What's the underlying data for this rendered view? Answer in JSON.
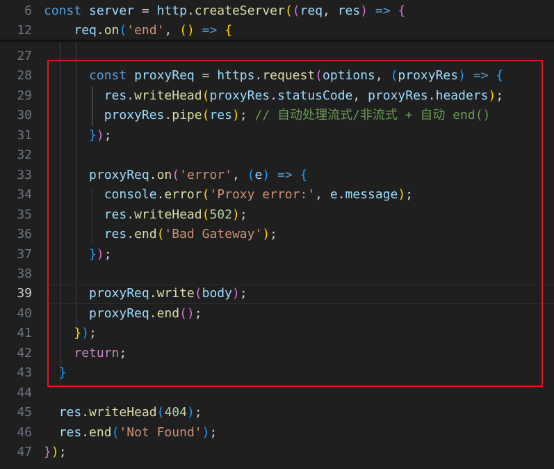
{
  "editor": {
    "active_line": "39",
    "sticky_lines": [
      {
        "num": "6",
        "code": [
          [
            "t-kw",
            "const "
          ],
          [
            "t-var",
            "server"
          ],
          [
            "t-op",
            " = "
          ],
          [
            "t-var",
            "http"
          ],
          [
            "t-op",
            "."
          ],
          [
            "t-fn",
            "createServer"
          ],
          [
            "t-b1",
            "("
          ],
          [
            "t-b2",
            "("
          ],
          [
            "t-var",
            "req"
          ],
          [
            "t-op",
            ", "
          ],
          [
            "t-var",
            "res"
          ],
          [
            "t-b2",
            ")"
          ],
          [
            "t-op",
            " "
          ],
          [
            "t-kw",
            "=>"
          ],
          [
            "t-op",
            " "
          ],
          [
            "t-b2",
            "{"
          ]
        ]
      },
      {
        "num": "12",
        "code": [
          [
            "t-op",
            "    "
          ],
          [
            "t-var",
            "req"
          ],
          [
            "t-op",
            "."
          ],
          [
            "t-fn",
            "on"
          ],
          [
            "t-b3",
            "("
          ],
          [
            "t-str",
            "'end'"
          ],
          [
            "t-op",
            ", "
          ],
          [
            "t-b1",
            "()"
          ],
          [
            "t-op",
            " "
          ],
          [
            "t-kw",
            "=>"
          ],
          [
            "t-op",
            " "
          ],
          [
            "t-b1",
            "{"
          ]
        ]
      }
    ],
    "lines": [
      {
        "num": "27",
        "code": [
          [
            "t-op",
            "    "
          ]
        ]
      },
      {
        "num": "28",
        "code": [
          [
            "t-op",
            "      "
          ],
          [
            "t-kw",
            "const "
          ],
          [
            "t-var",
            "proxyReq"
          ],
          [
            "t-op",
            " = "
          ],
          [
            "t-var",
            "https"
          ],
          [
            "t-op",
            "."
          ],
          [
            "t-fn",
            "request"
          ],
          [
            "t-b2",
            "("
          ],
          [
            "t-var",
            "options"
          ],
          [
            "t-op",
            ", "
          ],
          [
            "t-b3",
            "("
          ],
          [
            "t-var",
            "proxyRes"
          ],
          [
            "t-b3",
            ")"
          ],
          [
            "t-op",
            " "
          ],
          [
            "t-kw",
            "=>"
          ],
          [
            "t-op",
            " "
          ],
          [
            "t-b3",
            "{"
          ]
        ]
      },
      {
        "num": "29",
        "code": [
          [
            "t-op",
            "        "
          ],
          [
            "t-var",
            "res"
          ],
          [
            "t-op",
            "."
          ],
          [
            "t-fn",
            "writeHead"
          ],
          [
            "t-b1",
            "("
          ],
          [
            "t-var",
            "proxyRes"
          ],
          [
            "t-op",
            "."
          ],
          [
            "t-var",
            "statusCode"
          ],
          [
            "t-op",
            ", "
          ],
          [
            "t-var",
            "proxyRes"
          ],
          [
            "t-op",
            "."
          ],
          [
            "t-var",
            "headers"
          ],
          [
            "t-b1",
            ")"
          ],
          [
            "t-op",
            ";"
          ]
        ]
      },
      {
        "num": "30",
        "code": [
          [
            "t-op",
            "        "
          ],
          [
            "t-var",
            "proxyRes"
          ],
          [
            "t-op",
            "."
          ],
          [
            "t-fn",
            "pipe"
          ],
          [
            "t-b1",
            "("
          ],
          [
            "t-var",
            "res"
          ],
          [
            "t-b1",
            ")"
          ],
          [
            "t-op",
            "; "
          ],
          [
            "t-cmt",
            "// 自动处理流式/非流式 + 自动 end()"
          ]
        ]
      },
      {
        "num": "31",
        "code": [
          [
            "t-op",
            "      "
          ],
          [
            "t-b3",
            "}"
          ],
          [
            "t-b2",
            ")"
          ],
          [
            "t-op",
            ";"
          ]
        ]
      },
      {
        "num": "32",
        "code": [
          [
            "t-op",
            ""
          ]
        ]
      },
      {
        "num": "33",
        "code": [
          [
            "t-op",
            "      "
          ],
          [
            "t-var",
            "proxyReq"
          ],
          [
            "t-op",
            "."
          ],
          [
            "t-fn",
            "on"
          ],
          [
            "t-b2",
            "("
          ],
          [
            "t-str",
            "'error'"
          ],
          [
            "t-op",
            ", "
          ],
          [
            "t-b3",
            "("
          ],
          [
            "t-var",
            "e"
          ],
          [
            "t-b3",
            ")"
          ],
          [
            "t-op",
            " "
          ],
          [
            "t-kw",
            "=>"
          ],
          [
            "t-op",
            " "
          ],
          [
            "t-b3",
            "{"
          ]
        ]
      },
      {
        "num": "34",
        "code": [
          [
            "t-op",
            "        "
          ],
          [
            "t-var",
            "console"
          ],
          [
            "t-op",
            "."
          ],
          [
            "t-fn",
            "error"
          ],
          [
            "t-b1",
            "("
          ],
          [
            "t-str",
            "'Proxy error:'"
          ],
          [
            "t-op",
            ", "
          ],
          [
            "t-var",
            "e"
          ],
          [
            "t-op",
            "."
          ],
          [
            "t-var",
            "message"
          ],
          [
            "t-b1",
            ")"
          ],
          [
            "t-op",
            ";"
          ]
        ]
      },
      {
        "num": "35",
        "code": [
          [
            "t-op",
            "        "
          ],
          [
            "t-var",
            "res"
          ],
          [
            "t-op",
            "."
          ],
          [
            "t-fn",
            "writeHead"
          ],
          [
            "t-b1",
            "("
          ],
          [
            "t-num",
            "502"
          ],
          [
            "t-b1",
            ")"
          ],
          [
            "t-op",
            ";"
          ]
        ]
      },
      {
        "num": "36",
        "code": [
          [
            "t-op",
            "        "
          ],
          [
            "t-var",
            "res"
          ],
          [
            "t-op",
            "."
          ],
          [
            "t-fn",
            "end"
          ],
          [
            "t-b1",
            "("
          ],
          [
            "t-str",
            "'Bad Gateway'"
          ],
          [
            "t-b1",
            ")"
          ],
          [
            "t-op",
            ";"
          ]
        ]
      },
      {
        "num": "37",
        "code": [
          [
            "t-op",
            "      "
          ],
          [
            "t-b3",
            "}"
          ],
          [
            "t-b2",
            ")"
          ],
          [
            "t-op",
            ";"
          ]
        ]
      },
      {
        "num": "38",
        "code": [
          [
            "t-op",
            ""
          ]
        ]
      },
      {
        "num": "39",
        "code": [
          [
            "t-op",
            "      "
          ],
          [
            "t-var",
            "proxyReq"
          ],
          [
            "t-op",
            "."
          ],
          [
            "t-fn",
            "write"
          ],
          [
            "t-b2",
            "("
          ],
          [
            "t-var",
            "body"
          ],
          [
            "t-b2",
            ")"
          ],
          [
            "t-op",
            ";"
          ]
        ]
      },
      {
        "num": "40",
        "code": [
          [
            "t-op",
            "      "
          ],
          [
            "t-var",
            "proxyReq"
          ],
          [
            "t-op",
            "."
          ],
          [
            "t-fn",
            "end"
          ],
          [
            "t-b2",
            "()"
          ],
          [
            "t-op",
            ";"
          ]
        ]
      },
      {
        "num": "41",
        "code": [
          [
            "t-op",
            "    "
          ],
          [
            "t-b1",
            "}"
          ],
          [
            "t-b3",
            ")"
          ],
          [
            "t-op",
            ";"
          ]
        ]
      },
      {
        "num": "42",
        "code": [
          [
            "t-op",
            "    "
          ],
          [
            "t-ctl",
            "return"
          ],
          [
            "t-op",
            ";"
          ]
        ]
      },
      {
        "num": "43",
        "code": [
          [
            "t-op",
            "  "
          ],
          [
            "t-b3",
            "}"
          ]
        ]
      },
      {
        "num": "44",
        "code": [
          [
            "t-op",
            ""
          ]
        ]
      },
      {
        "num": "45",
        "code": [
          [
            "t-op",
            "  "
          ],
          [
            "t-var",
            "res"
          ],
          [
            "t-op",
            "."
          ],
          [
            "t-fn",
            "writeHead"
          ],
          [
            "t-b3",
            "("
          ],
          [
            "t-num",
            "404"
          ],
          [
            "t-b3",
            ")"
          ],
          [
            "t-op",
            ";"
          ]
        ]
      },
      {
        "num": "46",
        "code": [
          [
            "t-op",
            "  "
          ],
          [
            "t-var",
            "res"
          ],
          [
            "t-op",
            "."
          ],
          [
            "t-fn",
            "end"
          ],
          [
            "t-b3",
            "("
          ],
          [
            "t-str",
            "'Not Found'"
          ],
          [
            "t-b3",
            ")"
          ],
          [
            "t-op",
            ";"
          ]
        ]
      },
      {
        "num": "47",
        "code": [
          [
            "t-b2",
            "}"
          ],
          [
            "t-b1",
            ")"
          ],
          [
            "t-op",
            ";"
          ]
        ]
      }
    ]
  }
}
